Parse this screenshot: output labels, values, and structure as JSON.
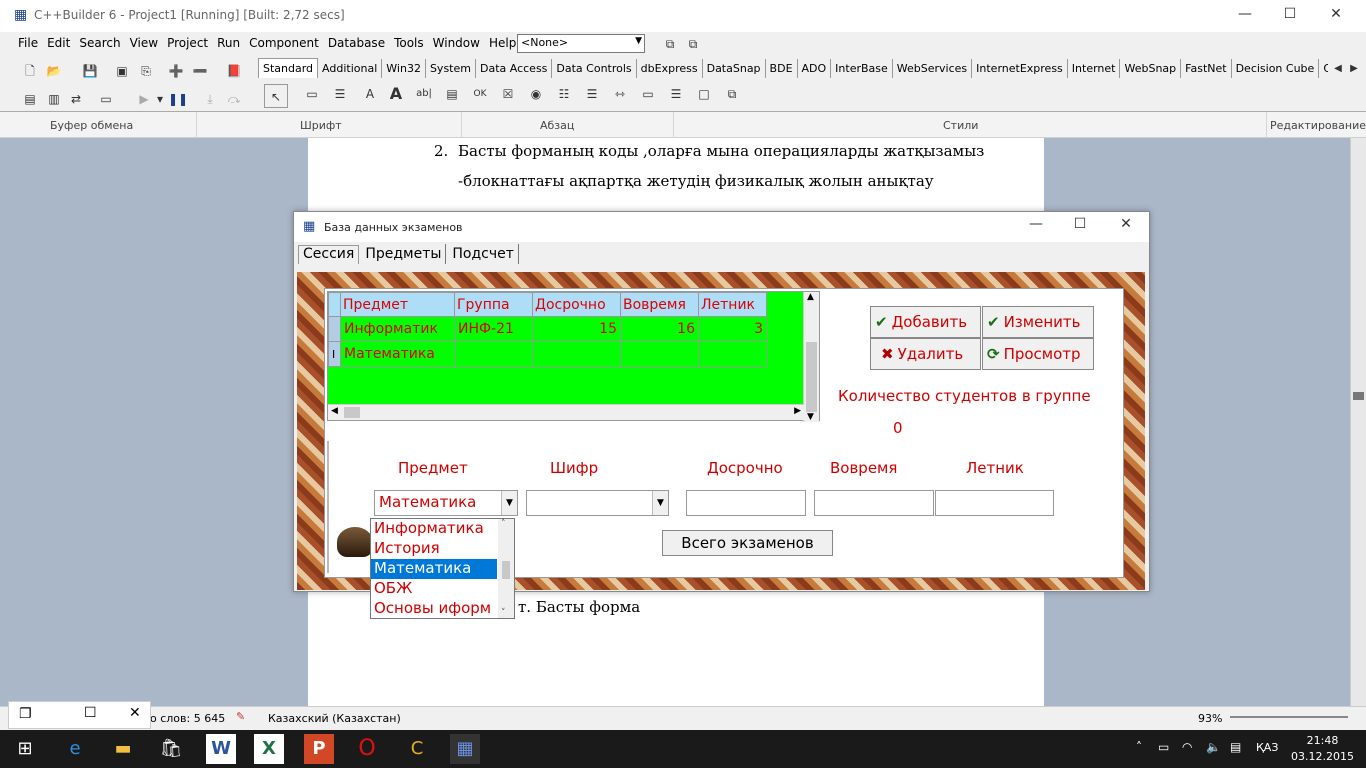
{
  "ide": {
    "title": "C++Builder 6 - Project1 [Running] [Built: 2,72 secs]",
    "menu": [
      "File",
      "Edit",
      "Search",
      "View",
      "Project",
      "Run",
      "Component",
      "Database",
      "Tools",
      "Window",
      "Help"
    ],
    "config_combo": "<None>",
    "palette_tabs": [
      "Standard",
      "Additional",
      "Win32",
      "System",
      "Data Access",
      "Data Controls",
      "dbExpress",
      "DataSnap",
      "BDE",
      "ADO",
      "InterBase",
      "WebServices",
      "InternetExpress",
      "Internet",
      "WebSnap",
      "FastNet",
      "Decision Cube",
      "QReport"
    ]
  },
  "word": {
    "ribbon_groups": [
      "Буфер обмена",
      "Шрифт",
      "Абзац",
      "Стили",
      "Редактирование"
    ],
    "doc_lines": {
      "line1_num": "2.",
      "line1": "Басты форманың коды ,оларға мына операцияларды жатқызамыз",
      "line2": "-блокнаттағы ақпартқа жетудің физикалық жолын анықтау",
      "caption": "т. Басты форма"
    },
    "status": {
      "words": "о слов: 5 645",
      "language": "Казахский (Казахстан)",
      "zoom": "93%"
    }
  },
  "dialog": {
    "title": "База данных экзаменов",
    "tabs": [
      "Сессия",
      "Предметы",
      "Подсчет"
    ],
    "grid": {
      "columns": [
        "Предмет",
        "Группа",
        "Досрочно",
        "Вовремя",
        "Летник"
      ],
      "rows": [
        [
          "Информатик",
          "ИНФ-21",
          "15",
          "16",
          "3"
        ],
        [
          "Математика",
          "",
          "",
          "",
          ""
        ]
      ]
    },
    "buttons": {
      "add": "Добавить",
      "edit": "Изменить",
      "delete": "Удалить",
      "view": "Просмотр",
      "total": "Всего экзаменов"
    },
    "count_label": "Количество студентов в группе",
    "count_value": "0",
    "field_labels": [
      "Предмет",
      "Шифр",
      "Досрочно",
      "Вовремя",
      "Летник"
    ],
    "subject_value": "Математика",
    "subject_options": [
      "Информатика",
      "История",
      "Математика",
      "ОБЖ",
      "Основы иформ"
    ],
    "selected_option_index": 2
  },
  "taskbar": {
    "lang": "ҚАЗ",
    "time": "21:48",
    "date": "03.12.2015"
  }
}
